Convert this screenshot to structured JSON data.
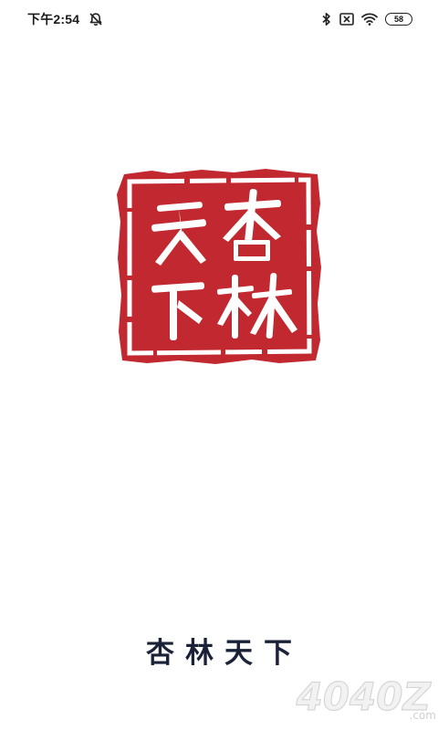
{
  "status_bar": {
    "time": "下午2:54",
    "battery_level": "58",
    "icons": [
      "alarm-off-icon",
      "bluetooth-icon",
      "sim-disabled-icon",
      "wifi-icon",
      "battery-icon"
    ]
  },
  "logo": {
    "seal_text": "杏林天下",
    "seal_color": "#c22830"
  },
  "app": {
    "title": "杏林天下"
  },
  "watermark": {
    "text": "4040Z",
    "suffix": ".com"
  }
}
